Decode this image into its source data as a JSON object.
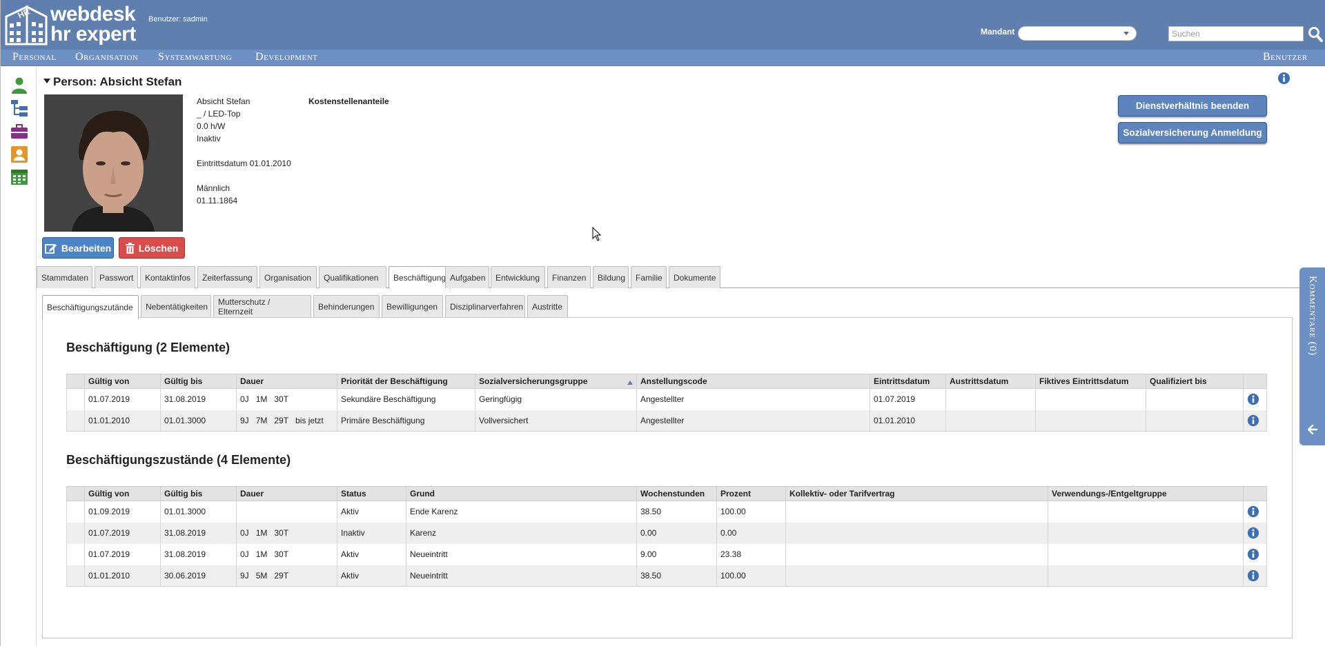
{
  "header": {
    "brand_line1": "webdesk",
    "brand_line2": "hr expert",
    "user_info": "Benutzer: sadmin",
    "mandant_label": "Mandant",
    "mandant_value": "",
    "search_placeholder": "Suchen"
  },
  "nav": {
    "items": [
      "Personal",
      "Organisation",
      "Systemwartung",
      "Development"
    ],
    "right": "Benutzer"
  },
  "sidebar_icons": [
    "person-icon",
    "org-tree-icon",
    "briefcase-icon",
    "contact-card-icon",
    "calendar-icon"
  ],
  "person": {
    "title": "Person: Absicht Stefan",
    "name": "Absicht Stefan",
    "position": "_ / LED-Top",
    "hours": "0.0 h/W",
    "status": "Inaktiv",
    "entry": "Eintrittsdatum 01.01.2010",
    "gender": "Männlich",
    "birthdate": "01.11.1864",
    "cost_center_label": "Kostenstellenanteile"
  },
  "buttons": {
    "edit": "Bearbeiten",
    "delete": "Löschen",
    "end_employment": "Dienstverhältnis beenden",
    "social_insurance": "Sozialversicherung Anmeldung"
  },
  "tabs": [
    "Stammdaten",
    "Passwort",
    "Kontaktinfos",
    "Zeiterfassung",
    "Organisation",
    "Qualifikationen",
    "Beschäftigung",
    "Aufgaben",
    "Entwicklung",
    "Finanzen",
    "Bildung",
    "Familie",
    "Dokumente"
  ],
  "active_tab": "Beschäftigung",
  "subtabs": [
    "Beschäftigungszutände",
    "Nebentätigkeiten",
    "Mutterschutz / Elternzeit",
    "Behinderungen",
    "Bewilligungen",
    "Disziplinarverfahren",
    "Austritte"
  ],
  "active_subtab": "Beschäftigungszutände",
  "employment": {
    "title": "Beschäftigung (2 Elemente)",
    "columns": [
      "Gültig von",
      "Gültig bis",
      "Dauer",
      "Priorität der Beschäftigung",
      "Sozialversicherungsgruppe",
      "Anstellungscode",
      "Eintrittsdatum",
      "Austrittsdatum",
      "Fiktives Eintrittsdatum",
      "Qualifiziert bis"
    ],
    "rows": [
      {
        "von": "01.07.2019",
        "bis": "31.08.2019",
        "dauer": [
          "0J",
          "1M",
          "30T",
          ""
        ],
        "prioritaet": "Sekundäre Beschäftigung",
        "svgruppe": "Geringfügig",
        "code": "Angestellter",
        "eintritt": "01.07.2019",
        "austritt": "",
        "fiktiv": "",
        "qualifiziert": ""
      },
      {
        "von": "01.01.2010",
        "bis": "01.01.3000",
        "dauer": [
          "9J",
          "7M",
          "29T",
          "bis jetzt"
        ],
        "prioritaet": "Primäre Beschäftigung",
        "svgruppe": "Vollversichert",
        "code": "Angestellter",
        "eintritt": "01.01.2010",
        "austritt": "",
        "fiktiv": "",
        "qualifiziert": ""
      }
    ]
  },
  "states": {
    "title": "Beschäftigungszustände (4 Elemente)",
    "columns": [
      "Gültig von",
      "Gültig bis",
      "Dauer",
      "Status",
      "Grund",
      "Wochenstunden",
      "Prozent",
      "Kollektiv- oder Tarifvertrag",
      "Verwendungs-/Entgeltgruppe"
    ],
    "rows": [
      {
        "von": "01.09.2019",
        "bis": "01.01.3000",
        "dauer": [
          "",
          "",
          ""
        ],
        "status": "Aktiv",
        "grund": "Ende Karenz",
        "stunden": "38.50",
        "prozent": "100.00",
        "kollektiv": "",
        "gruppe": ""
      },
      {
        "von": "01.07.2019",
        "bis": "31.08.2019",
        "dauer": [
          "0J",
          "1M",
          "30T"
        ],
        "status": "Inaktiv",
        "grund": "Karenz",
        "stunden": "0.00",
        "prozent": "0.00",
        "kollektiv": "",
        "gruppe": ""
      },
      {
        "von": "01.07.2019",
        "bis": "31.08.2019",
        "dauer": [
          "0J",
          "1M",
          "30T"
        ],
        "status": "Aktiv",
        "grund": "Neueintritt",
        "stunden": "9.00",
        "prozent": "23.38",
        "kollektiv": "",
        "gruppe": ""
      },
      {
        "von": "01.01.2010",
        "bis": "30.06.2019",
        "dauer": [
          "9J",
          "5M",
          "29T"
        ],
        "status": "Aktiv",
        "grund": "Neueintritt",
        "stunden": "38.50",
        "prozent": "100.00",
        "kollektiv": "",
        "gruppe": ""
      }
    ]
  },
  "comments": {
    "label": "Kommentare (0)"
  },
  "colors": {
    "header": "#5f7fae",
    "nav": "#6d90c4",
    "primary_button": "#4d84c5",
    "danger_button": "#d94c4c",
    "info_icon": "#3f6fb0"
  }
}
